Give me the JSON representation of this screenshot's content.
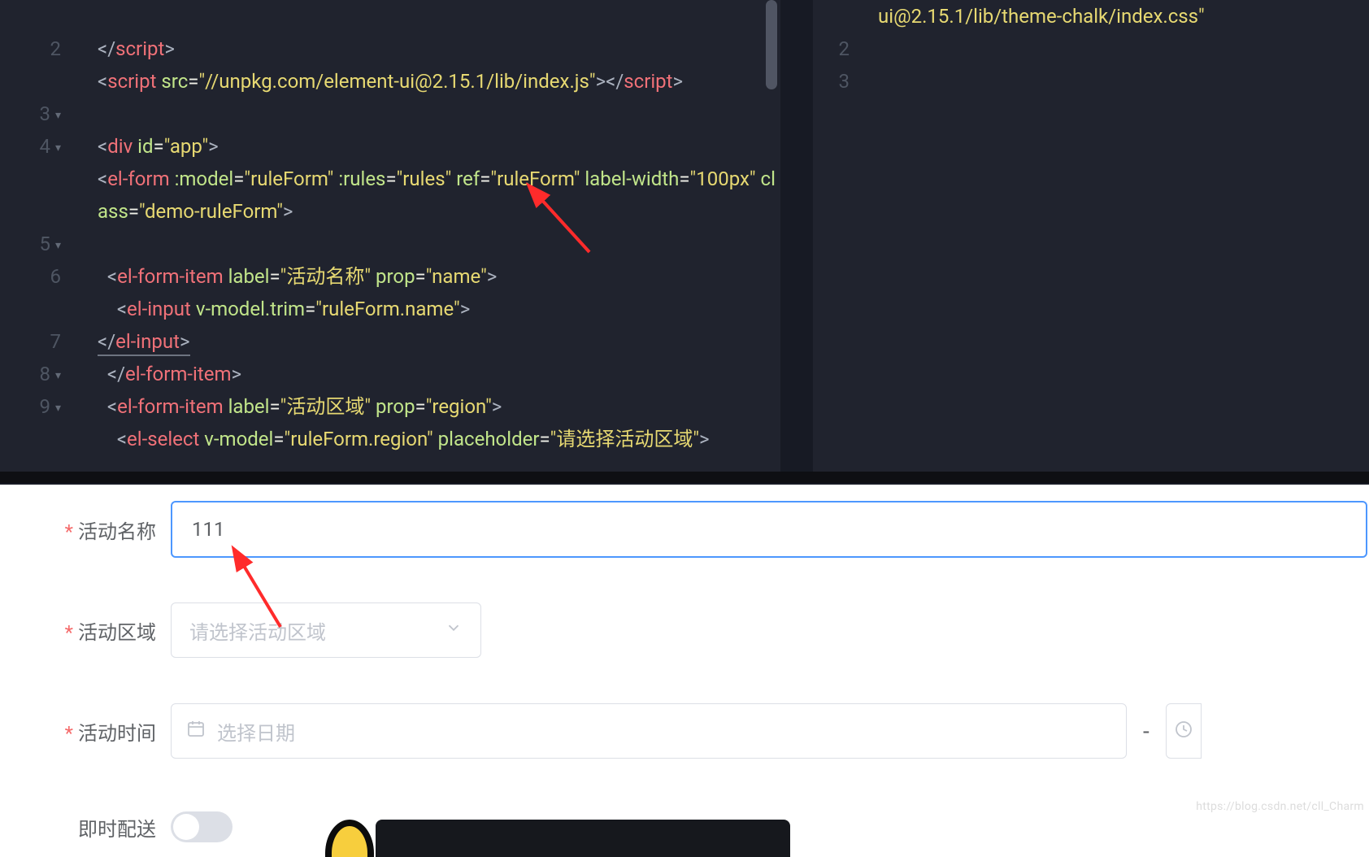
{
  "left_editor": {
    "gutter": [
      "",
      "2",
      "3",
      "4",
      "5",
      "6",
      "7",
      "8",
      "9"
    ],
    "fold_lines": [
      3,
      4,
      5,
      8,
      9
    ],
    "css_link": "ui@2.15.1/lib/theme-chalk/index.css",
    "script_src": "//unpkg.com/element-ui@2.15.1/lib/index.js",
    "div_id": "app",
    "form_model": "ruleForm",
    "form_rules": "rules",
    "form_ref": "ruleForm",
    "label_width": "100px",
    "form_class": "demo-ruleForm",
    "item1_label": "活动名称",
    "item1_prop": "name",
    "input1_model": "ruleForm.name",
    "item2_label": "活动区域",
    "item2_prop": "region",
    "select_model": "ruleForm.region",
    "select_placeholder": "请选择活动区域"
  },
  "right_editor": {
    "gutter": [
      "",
      "2",
      "3"
    ],
    "line1": "ui@2.15.1/lib/theme-chalk/index.css\""
  },
  "form": {
    "label_name": "活动名称",
    "value_name": "111",
    "label_region": "活动区域",
    "placeholder_region": "请选择活动区域",
    "label_time": "活动时间",
    "placeholder_date": "选择日期",
    "separator": "-",
    "label_immediate": "即时配送"
  },
  "watermark": "https://blog.csdn.net/cll_Charm"
}
